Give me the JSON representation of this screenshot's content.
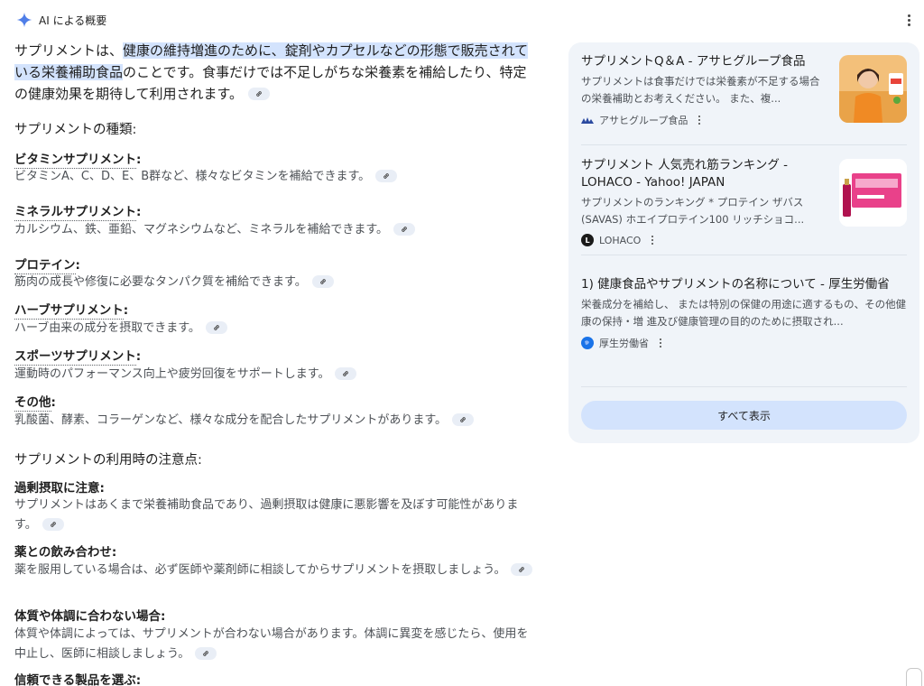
{
  "header": {
    "title": "AI による概要"
  },
  "intro": {
    "pre": "サプリメントは、",
    "highlight": "健康の維持増進のために、錠剤やカプセルなどの形態で販売されている栄養補助食品",
    "post": "のことです。食事だけでは不足しがちな栄養素を補給したり、特定の健康効果を期待して利用されます。"
  },
  "types": {
    "heading": "サプリメントの種類:",
    "items": [
      {
        "title": "ビタミンサプリメント",
        "desc": "ビタミンA、C、D、E、B群など、様々なビタミンを補給できます。"
      },
      {
        "title": "ミネラルサプリメント",
        "desc": "カルシウム、鉄、亜鉛、マグネシウムなど、ミネラルを補給できます。"
      },
      {
        "title": "プロテイン",
        "desc": "筋肉の成長や修復に必要なタンパク質を補給できます。"
      },
      {
        "title": "ハーブサプリメント",
        "desc": "ハーブ由来の成分を摂取できます。"
      },
      {
        "title": "スポーツサプリメント",
        "desc": "運動時のパフォーマンス向上や疲労回復をサポートします。"
      },
      {
        "title": "その他",
        "desc": "乳酸菌、酵素、コラーゲンなど、様々な成分を配合したサプリメントがあります。"
      }
    ]
  },
  "cautions": {
    "heading": "サプリメントの利用時の注意点:",
    "items": [
      {
        "title": "過剰摂取に注意",
        "desc": "サプリメントはあくまで栄養補助食品であり、過剰摂取は健康に悪影響を及ぼす可能性があります。"
      },
      {
        "title": "薬との飲み合わせ",
        "desc": "薬を服用している場合は、必ず医師や薬剤師に相談してからサプリメントを摂取しましょう。"
      },
      {
        "title": "体質や体調に合わない場合",
        "desc": "体質や体調によっては、サプリメントが合わない場合があります。体調に異変を感じたら、使用を中止し、医師に相談しましょう。"
      },
      {
        "title": "信頼できる製品を選ぶ",
        "desc": ""
      }
    ]
  },
  "sources": {
    "cards": [
      {
        "title": "サプリメントQ＆A - アサヒグループ食品",
        "snippet": "サプリメントは食事だけでは栄養素が不足する場合の栄養補助とお考えください。 また、複...",
        "source": "アサヒグループ食品"
      },
      {
        "title": "サプリメント 人気売れ筋ランキング - LOHACO - Yahoo! JAPAN",
        "snippet": "サプリメントのランキング * プロテイン ザバス(SAVAS) ホエイプロテイン100 リッチショコ...",
        "source": "LOHACO"
      },
      {
        "title": "1) 健康食品やサプリメントの名称について - 厚生労働省",
        "snippet": "栄養成分を補給し、 または特別の保健の用途に適するもの、その他健康の保持・増 進及び健康管理の目的のために摂取され...",
        "source": "厚生労働省"
      }
    ],
    "show_all": "すべて表示"
  },
  "colors": {
    "panel": "#f0f4f9",
    "highlight": "#d3e3fd",
    "button": "#d3e3fd"
  }
}
